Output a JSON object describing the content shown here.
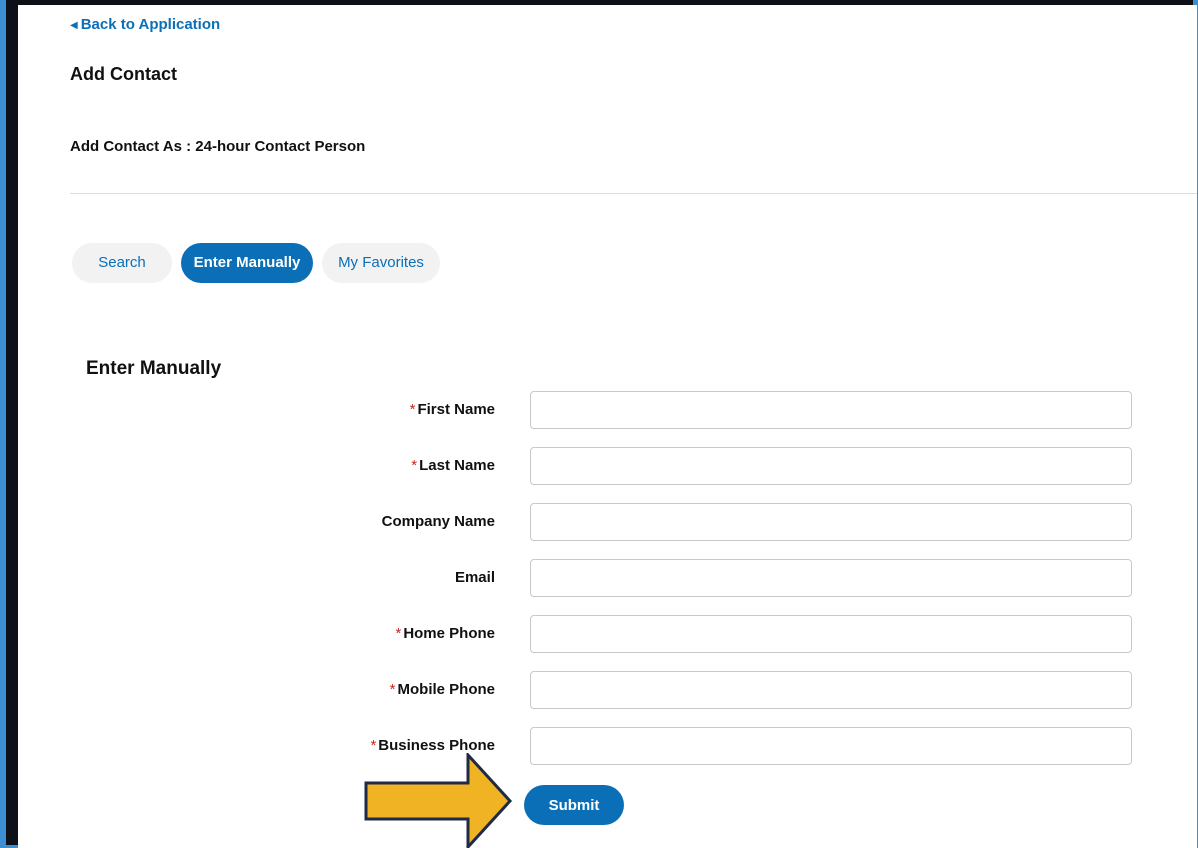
{
  "header": {
    "back_link": "Back to Application",
    "title": "Add Contact",
    "add_contact_as_label": "Add Contact As",
    "add_contact_as_value": ": 24-hour Contact Person"
  },
  "tabs": [
    {
      "label": "Search",
      "active": false
    },
    {
      "label": "Enter Manually",
      "active": true
    },
    {
      "label": "My Favorites",
      "active": false
    }
  ],
  "form": {
    "section_title": "Enter Manually",
    "fields": [
      {
        "label": "First Name",
        "required": true,
        "value": "",
        "placeholder": ""
      },
      {
        "label": "Last Name",
        "required": true,
        "value": "",
        "placeholder": ""
      },
      {
        "label": "Company Name",
        "required": false,
        "value": "",
        "placeholder": ""
      },
      {
        "label": "Email",
        "required": false,
        "value": "",
        "placeholder": ""
      },
      {
        "label": "Home Phone",
        "required": true,
        "value": "",
        "placeholder": ""
      },
      {
        "label": "Mobile Phone",
        "required": true,
        "value": "",
        "placeholder": ""
      },
      {
        "label": "Business Phone",
        "required": true,
        "value": "",
        "placeholder": ""
      }
    ],
    "required_marker": "*",
    "submit_label": "Submit"
  },
  "colors": {
    "accent": "#0b6fb8",
    "required": "#c8281d",
    "annotation_arrow": "#f0b323",
    "page_border": "#3b8fd2"
  },
  "icons": {
    "back_caret": "caret-left-icon",
    "annotation": "arrow-right-icon"
  }
}
